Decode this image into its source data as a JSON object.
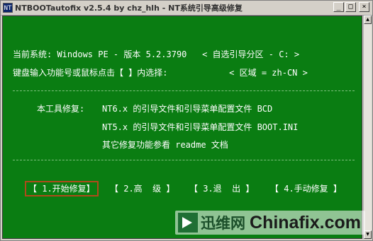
{
  "window": {
    "title": "NTBOOTautofix v2.5.4 by chz_hlh - NT系统引导高级修复",
    "app_icon": "NT",
    "controls": {
      "minimize": "_",
      "maximize": "□",
      "close": "×"
    }
  },
  "info": {
    "system_line": "当前系统: Windows PE - 版本 5.2.3790   < 自选引导分区 - C: >",
    "input_line": "键盘输入功能号或鼠标点击【 】内选择:            < 区域 = zh-CN >"
  },
  "tool_desc": {
    "label": "本工具修复:",
    "line1": "NT6.x 的引导文件和引导菜单配置文件 BCD",
    "line2": "NT5.x 的引导文件和引导菜单配置文件 BOOT.INI",
    "line3": "其它修复功能参看 readme 文档"
  },
  "menu": [
    {
      "label": "【 1.开始修复】",
      "selected": true
    },
    {
      "label": "【 2.高  级 】",
      "selected": false
    },
    {
      "label": "【 3.退  出 】",
      "selected": false
    },
    {
      "label": "【 4.手动修复 】",
      "selected": false
    }
  ],
  "watermark": {
    "cn": "迅维网",
    "en": "Chinafix.com",
    "icon": "play-arrow-logo"
  },
  "scrollbar": {
    "up": "▲",
    "down": "▼"
  },
  "colors": {
    "console_bg": "#0a7d12",
    "console_text": "#ffffff",
    "selected_border": "#b04a1a"
  }
}
